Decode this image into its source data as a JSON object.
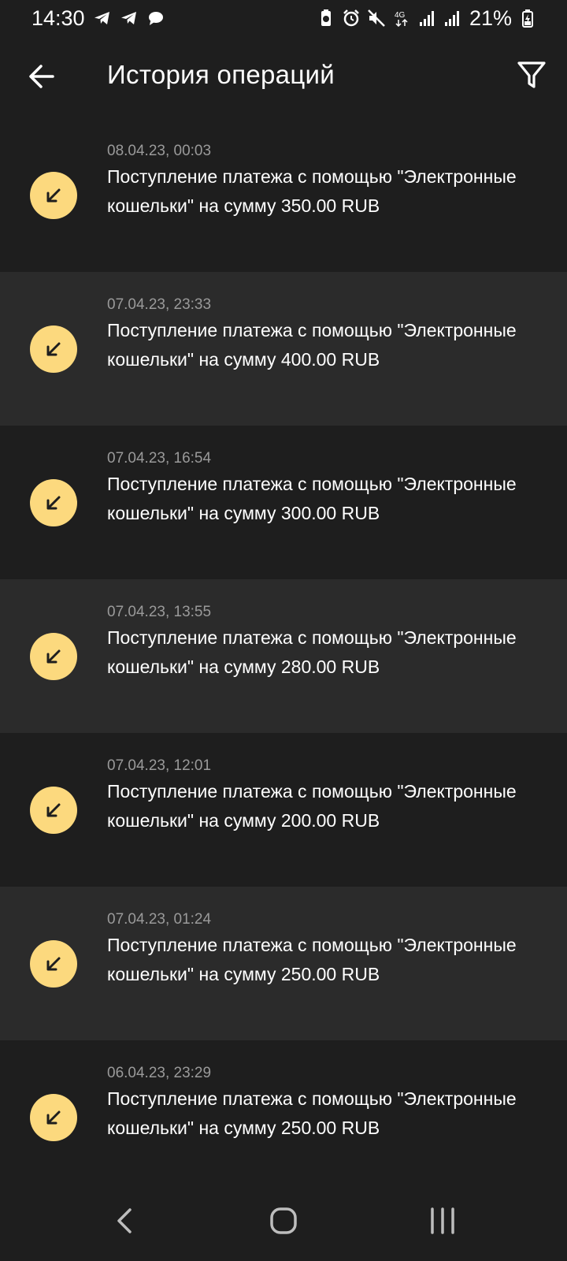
{
  "status_bar": {
    "time": "14:30",
    "battery_percent": "21%",
    "network": "4G",
    "left_icons": [
      "telegram-icon",
      "telegram-icon",
      "message-bubble-icon"
    ],
    "right_icons": [
      "battery-saver-icon",
      "alarm-icon",
      "mute-icon",
      "network-4g-icon",
      "signal-icon",
      "signal-icon",
      "battery-charging-icon"
    ]
  },
  "app_bar": {
    "title": "История операций",
    "back_icon": "arrow-left-icon",
    "filter_icon": "filter-icon"
  },
  "operations": [
    {
      "date": "08.04.23, 00:03",
      "description": "Поступление платежа с помощью \"Электронные кошельки\" на сумму 350.00 RUB",
      "icon": "incoming-arrow-icon"
    },
    {
      "date": "07.04.23, 23:33",
      "description": "Поступление платежа с помощью \"Электронные кошельки\" на сумму 400.00 RUB",
      "icon": "incoming-arrow-icon"
    },
    {
      "date": "07.04.23, 16:54",
      "description": "Поступление платежа с помощью \"Электронные кошельки\" на сумму 300.00 RUB",
      "icon": "incoming-arrow-icon"
    },
    {
      "date": "07.04.23, 13:55",
      "description": "Поступление платежа с помощью \"Электронные кошельки\" на сумму 280.00 RUB",
      "icon": "incoming-arrow-icon"
    },
    {
      "date": "07.04.23, 12:01",
      "description": "Поступление платежа с помощью \"Электронные кошельки\" на сумму 200.00 RUB",
      "icon": "incoming-arrow-icon"
    },
    {
      "date": "07.04.23, 01:24",
      "description": "Поступление платежа с помощью \"Электронные кошельки\" на сумму 250.00 RUB",
      "icon": "incoming-arrow-icon"
    },
    {
      "date": "06.04.23, 23:29",
      "description": "Поступление платежа с помощью \"Электронные кошельки\" на сумму 250.00 RUB",
      "icon": "incoming-arrow-icon"
    }
  ],
  "nav_bar": {
    "icons": [
      "nav-back-icon",
      "nav-home-icon",
      "nav-recent-apps-icon"
    ]
  },
  "colors": {
    "background": "#1e1e1e",
    "row_alt": "#2b2b2b",
    "accent_icon_bg": "#fcd97e",
    "date_text": "#9a9a9a",
    "text": "#ffffff"
  }
}
